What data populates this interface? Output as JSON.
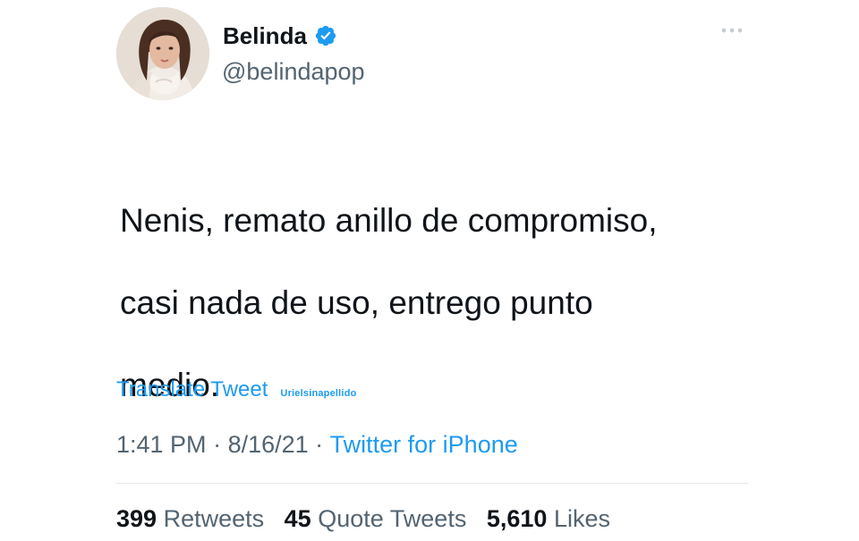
{
  "user": {
    "display_name": "Belinda",
    "handle": "@belindapop",
    "verified_icon": "verified-badge-icon",
    "avatar_icon": "avatar"
  },
  "tweet": {
    "text_lines": [
      "Nenis, remato anillo de compromiso,",
      "casi nada de uso, entrego punto",
      "medio."
    ],
    "translate_label": "Translate Tweet",
    "watermark": "Urielsinapellido",
    "time": "1:41 PM",
    "separator": " · ",
    "date": "8/16/21",
    "source": "Twitter for iPhone"
  },
  "stats": [
    {
      "count": "399",
      "label": "Retweets"
    },
    {
      "count": "45",
      "label": "Quote Tweets"
    },
    {
      "count": "5,610",
      "label": "Likes"
    }
  ],
  "colors": {
    "accent": "#1d9bf0",
    "text": "#0f1419",
    "secondary": "#536471",
    "divider": "#e3e7ea"
  }
}
